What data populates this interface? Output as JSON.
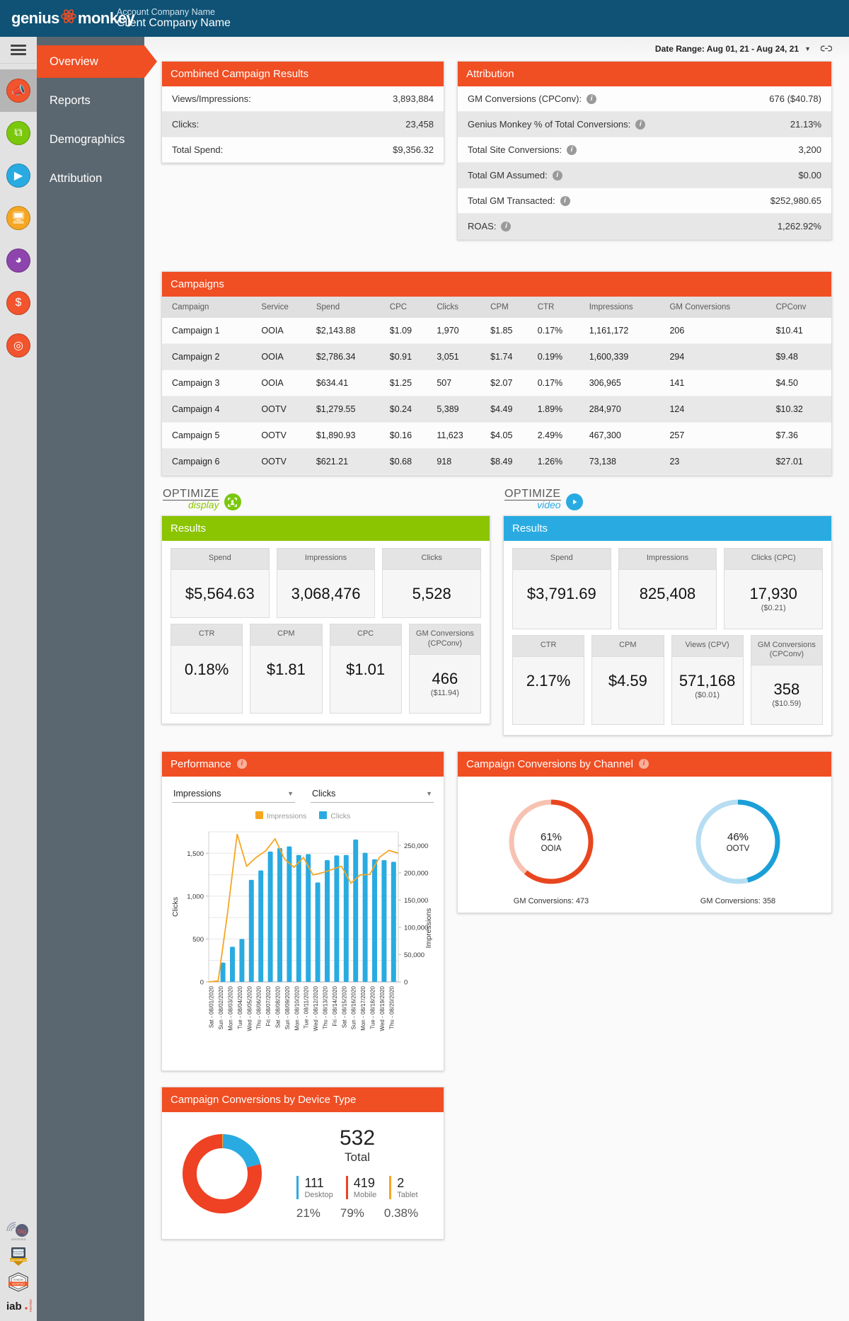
{
  "header": {
    "logo_text_left": "genius",
    "logo_text_right": "monkey",
    "account_name": "Account Company Name",
    "client_name": "Client Company Name"
  },
  "daterange": {
    "label": "Date Range: Aug 01, 21 - Aug 24, 21",
    "caret": "▼",
    "link_icon": "🔗"
  },
  "nav": {
    "items": [
      {
        "label": "Overview",
        "active": true
      },
      {
        "label": "Reports",
        "active": false
      },
      {
        "label": "Demographics",
        "active": false
      },
      {
        "label": "Attribution",
        "active": false
      }
    ]
  },
  "rail": {
    "icons": [
      {
        "name": "megaphone-icon",
        "glyph": "📣",
        "color": "#f2542d",
        "active": true
      },
      {
        "name": "display-target-icon",
        "glyph": "⧉",
        "color": "#7ac70c",
        "active": false
      },
      {
        "name": "video-play-icon",
        "glyph": "▶",
        "color": "#29abe2",
        "active": false
      },
      {
        "name": "ctv-screen-icon",
        "glyph": "🖥",
        "color": "#f5a623",
        "active": false
      },
      {
        "name": "audience-head-icon",
        "glyph": "◕",
        "color": "#8e44ad",
        "active": false
      },
      {
        "name": "dollar-icon",
        "glyph": "$",
        "color": "#f2542d",
        "active": false
      },
      {
        "name": "chat-icon",
        "glyph": "◎",
        "color": "#f2542d",
        "active": false
      }
    ],
    "badges": [
      "tag-certified-badge",
      "compliance-seal-badge",
      "evidon-verified-badge",
      "iab-member-badge"
    ]
  },
  "combined_results": {
    "title": "Combined Campaign Results",
    "rows": [
      {
        "label": "Views/Impressions:",
        "value": "3,893,884"
      },
      {
        "label": "Clicks:",
        "value": "23,458"
      },
      {
        "label": "Total Spend:",
        "value": "$9,356.32"
      }
    ]
  },
  "attribution": {
    "title": "Attribution",
    "rows": [
      {
        "label": "GM Conversions (CPConv):",
        "value": "676 ($40.78)",
        "info": true
      },
      {
        "label": "Genius Monkey % of Total Conversions:",
        "value": "21.13%",
        "info": true
      },
      {
        "label": "Total Site Conversions:",
        "value": "3,200",
        "info": true
      },
      {
        "label": "Total GM Assumed:",
        "value": "$0.00",
        "info": true
      },
      {
        "label": "Total GM Transacted:",
        "value": "$252,980.65",
        "info": true
      },
      {
        "label": "ROAS:",
        "value": "1,262.92%",
        "info": true
      }
    ]
  },
  "campaigns": {
    "title": "Campaigns",
    "columns": [
      "Campaign",
      "Service",
      "Spend",
      "CPC",
      "Clicks",
      "CPM",
      "CTR",
      "Impressions",
      "GM Conversions",
      "CPConv"
    ],
    "rows": [
      [
        "Campaign 1",
        "OOIA",
        "$2,143.88",
        "$1.09",
        "1,970",
        "$1.85",
        "0.17%",
        "1,161,172",
        "206",
        "$10.41"
      ],
      [
        "Campaign 2",
        "OOIA",
        "$2,786.34",
        "$0.91",
        "3,051",
        "$1.74",
        "0.19%",
        "1,600,339",
        "294",
        "$9.48"
      ],
      [
        "Campaign 3",
        "OOIA",
        "$634.41",
        "$1.25",
        "507",
        "$2.07",
        "0.17%",
        "306,965",
        "141",
        "$4.50"
      ],
      [
        "Campaign 4",
        "OOTV",
        "$1,279.55",
        "$0.24",
        "5,389",
        "$4.49",
        "1.89%",
        "284,970",
        "124",
        "$10.32"
      ],
      [
        "Campaign 5",
        "OOTV",
        "$1,890.93",
        "$0.16",
        "11,623",
        "$4.05",
        "2.49%",
        "467,300",
        "257",
        "$7.36"
      ],
      [
        "Campaign 6",
        "OOTV",
        "$621.21",
        "$0.68",
        "918",
        "$8.49",
        "1.26%",
        "73,138",
        "23",
        "$27.01"
      ]
    ]
  },
  "optimize_display": {
    "logo_top": "OPTIMIZE",
    "logo_bottom": "display",
    "accent": "#8bc400",
    "results_title": "Results",
    "row1": [
      {
        "label": "Spend",
        "value": "$5,564.63",
        "sub": ""
      },
      {
        "label": "Impressions",
        "value": "3,068,476",
        "sub": ""
      },
      {
        "label": "Clicks",
        "value": "5,528",
        "sub": ""
      }
    ],
    "row2": [
      {
        "label": "CTR",
        "value": "0.18%",
        "sub": ""
      },
      {
        "label": "CPM",
        "value": "$1.81",
        "sub": ""
      },
      {
        "label": "CPC",
        "value": "$1.01",
        "sub": ""
      },
      {
        "label": "GM Conversions (CPConv)",
        "value": "466",
        "sub": "($11.94)"
      }
    ]
  },
  "optimize_video": {
    "logo_top": "OPTIMIZE",
    "logo_bottom": "video",
    "accent": "#29abe2",
    "results_title": "Results",
    "row1": [
      {
        "label": "Spend",
        "value": "$3,791.69",
        "sub": ""
      },
      {
        "label": "Impressions",
        "value": "825,408",
        "sub": ""
      },
      {
        "label": "Clicks (CPC)",
        "value": "17,930",
        "sub": "($0.21)"
      }
    ],
    "row2": [
      {
        "label": "CTR",
        "value": "2.17%",
        "sub": ""
      },
      {
        "label": "CPM",
        "value": "$4.59",
        "sub": ""
      },
      {
        "label": "Views (CPV)",
        "value": "571,168",
        "sub": "($0.01)"
      },
      {
        "label": "GM Conversions (CPConv)",
        "value": "358",
        "sub": "($10.59)"
      }
    ]
  },
  "performance": {
    "title": "Performance",
    "select_left": "Impressions",
    "select_right": "Clicks",
    "caret": "▼"
  },
  "channel": {
    "title": "Campaign Conversions by Channel",
    "donuts": [
      {
        "pct_label": "61%",
        "name": "OOIA",
        "caption": "GM Conversions: 473",
        "color": "#e8461f",
        "track": "#f7c2b2",
        "pct": 61
      },
      {
        "pct_label": "46%",
        "name": "OOTV",
        "caption": "GM Conversions: 358",
        "color": "#1b9fd8",
        "track": "#b6ddf2",
        "pct": 46
      }
    ]
  },
  "device": {
    "title": "Campaign Conversions by Device Type",
    "total": "532",
    "total_label": "Total",
    "items": [
      {
        "n": "111",
        "label": "Desktop",
        "pct": "21%",
        "color": "#29abe2",
        "value": 21
      },
      {
        "n": "419",
        "label": "Mobile",
        "pct": "79%",
        "color": "#ef4123",
        "value": 79
      },
      {
        "n": "2",
        "label": "Tablet",
        "pct": "0.38%",
        "color": "#f5a623",
        "value": 0.38
      }
    ]
  },
  "chart_data": {
    "type": "bar",
    "title": "Performance",
    "xlabel": "",
    "ylabel": "Clicks",
    "y2label": "Impressions",
    "ylim": [
      0,
      1750
    ],
    "y2lim": [
      0,
      275000
    ],
    "yticks": [
      0,
      500,
      1000,
      1500
    ],
    "y2ticks": [
      0,
      50000,
      100000,
      150000,
      200000,
      250000
    ],
    "grid": true,
    "legend_position": "top-center",
    "legend": [
      "Impressions",
      "Clicks"
    ],
    "colors": {
      "Impressions": "#f5a623",
      "Clicks": "#29abe2"
    },
    "categories": [
      "Sat - 08/01/2020",
      "Sun - 08/02/2020",
      "Mon - 08/03/2020",
      "Tue - 08/04/2020",
      "Wed - 08/05/2020",
      "Thu - 08/06/2020",
      "Fri - 08/07/2020",
      "Sat - 08/08/2020",
      "Sun - 08/09/2020",
      "Mon - 08/10/2020",
      "Tue - 08/11/2020",
      "Wed - 08/12/2020",
      "Thu - 08/13/2020",
      "Fri - 08/14/2020",
      "Sat - 08/15/2020",
      "Sun - 08/16/2020",
      "Mon - 08/17/2020",
      "Tue - 08/18/2020",
      "Wed - 08/19/2020",
      "Thu - 08/20/2020"
    ],
    "series": [
      {
        "name": "Clicks",
        "type": "bar",
        "axis": "left",
        "values": [
          0,
          225,
          410,
          500,
          1190,
          1300,
          1520,
          1560,
          1580,
          1480,
          1490,
          1160,
          1420,
          1475,
          1480,
          1660,
          1505,
          1430,
          1420,
          1400
        ]
      },
      {
        "name": "Impressions",
        "type": "line",
        "axis": "right",
        "values": [
          0,
          2000,
          128000,
          271000,
          212000,
          228000,
          240000,
          262000,
          225000,
          210000,
          228000,
          196000,
          200000,
          206000,
          212000,
          181000,
          196000,
          197000,
          228000,
          241000,
          236000
        ]
      }
    ]
  }
}
